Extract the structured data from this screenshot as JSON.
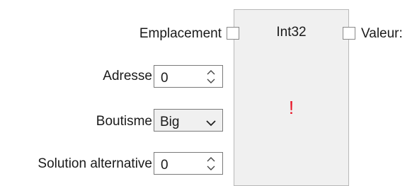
{
  "block": {
    "title": "Int32",
    "warning": "!"
  },
  "ports": {
    "input_label": "Emplacement",
    "output_label": "Valeur:"
  },
  "fields": {
    "adresse": {
      "label": "Adresse",
      "value": "0"
    },
    "boutisme": {
      "label": "Boutisme",
      "value": "Big"
    },
    "solution": {
      "label": "Solution alternative",
      "value": "0"
    }
  },
  "icons": {
    "spin_up": "chevron-up-icon",
    "spin_down": "chevron-down-icon",
    "dropdown": "chevron-down-icon"
  },
  "colors": {
    "warning": "#e81123",
    "block_bg": "#f0f0f0"
  }
}
